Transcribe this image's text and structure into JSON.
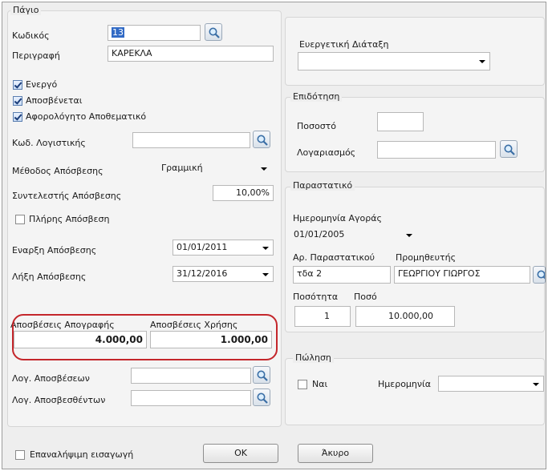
{
  "asset": {
    "title": "Πάγιο",
    "code_label": "Κωδικός",
    "code_value": "13",
    "description_label": "Περιγραφή",
    "description_value": "ΚΑΡΕΚΛΑ",
    "active_label": "Ενεργό",
    "active_checked": true,
    "depreciable_label": "Αποσβένεται",
    "depreciable_checked": true,
    "taxfree_label": "Αφορολόγητο Αποθεματικό",
    "taxfree_checked": true,
    "account_code_label": "Κωδ. Λογιστικής",
    "account_code_value": "",
    "method_label": "Μέθοδος Απόσβεσης",
    "method_value": "Γραμμική",
    "rate_label": "Συντελεστής Απόσβεσης",
    "rate_value": "10,00%",
    "full_label": "Πλήρης Απόσβεση",
    "full_checked": false,
    "start_label": "Εναρξη Απόσβεσης",
    "start_value": "01/01/2011",
    "end_label": "Λήξη Απόσβεσης",
    "end_value": "31/12/2016",
    "inventory_dep_label": "Αποσβέσεις Απογραφής",
    "inventory_dep_value": "4.000,00",
    "usage_dep_label": "Αποσβέσεις Χρήσης",
    "usage_dep_value": "1.000,00",
    "dep_account_label": "Λογ. Αποσβέσεων",
    "dep_account_value": "",
    "depd_account_label": "Λογ. Αποσβεσθέντων",
    "depd_account_value": ""
  },
  "beneficial": {
    "label": "Ευεργετική Διάταξη",
    "value": ""
  },
  "subsidy": {
    "title": "Επιδότηση",
    "percent_label": "Ποσοστό",
    "percent_value": "",
    "account_label": "Λογαριασμός",
    "account_value": ""
  },
  "document": {
    "title": "Παραστατικό",
    "purchase_date_label": "Ημερομηνία Αγοράς",
    "purchase_date_value": "01/01/2005",
    "doc_no_label": "Αρ. Παραστατικού",
    "doc_no_value": "τδα 2",
    "supplier_label": "Προμηθευτής",
    "supplier_value": "ΓΕΩΡΓΙΟΥ ΓΙΩΡΓΟΣ",
    "qty_label": "Ποσότητα",
    "qty_value": "1",
    "amount_label": "Ποσό",
    "amount_value": "10.000,00"
  },
  "sale": {
    "title": "Πώληση",
    "yes_label": "Ναι",
    "yes_checked": false,
    "date_label": "Ημερομηνία",
    "date_value": ""
  },
  "footer": {
    "repeat_label": "Επαναλήψιμη εισαγωγή",
    "repeat_checked": false,
    "ok_label": "OK",
    "cancel_label": "Άκυρο"
  }
}
